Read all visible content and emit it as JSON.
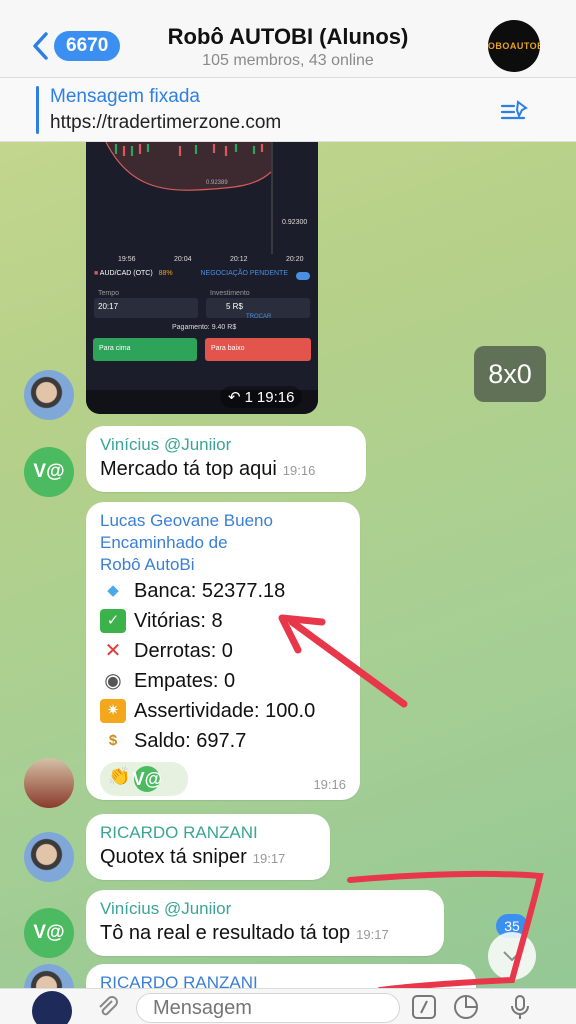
{
  "header": {
    "back_count": "6670",
    "title": "Robô AUTOBI (Alunos)",
    "subtitle": "105 membros, 43 online",
    "avatar_text": "ROBOAUTOBI"
  },
  "pinned": {
    "title": "Mensagem fixada",
    "text": "https://tradertimerzone.com"
  },
  "screenshot": {
    "price_label": "0.92300",
    "price_small": "0.92389",
    "times": [
      "19:56",
      "20:04",
      "20:12",
      "20:20"
    ],
    "pair": "AUD/CAD (OTC)",
    "pct": "88%",
    "pending": "NEGOCIAÇÃO PENDENTE",
    "tempo_label": "Tempo",
    "tempo_value": "20:17",
    "invest_label": "Investimento",
    "invest_value": "5 R$",
    "trocar": "TROCAR",
    "pagamento": "Pagamento: 9.40 R$",
    "up_label": "Para cima",
    "down_label": "Para baixo"
  },
  "reply_pill": {
    "count": "1",
    "time": "19:16"
  },
  "score_pill": "8x0",
  "messages": [
    {
      "sender": "Vinícius @Juniior",
      "text": "Mercado tá top aqui",
      "time": "19:16"
    },
    {
      "sender": "Lucas Geovane Bueno",
      "forwarded_label": "Encaminhado de",
      "forwarded_from": "Robô AutoBi",
      "stats": {
        "banca": "Banca: 52377.18",
        "vitorias": "Vitórias: 8",
        "derrotas": "Derrotas: 0",
        "empates": "Empates: 0",
        "assertividade": "Assertividade: 100.0",
        "saldo": "Saldo: 697.7"
      },
      "time": "19:16"
    },
    {
      "sender": "RICARDO RANZANI",
      "text": "Quotex tá sniper",
      "time": "19:17"
    },
    {
      "sender": "Vinícius @Juniior",
      "text": "Tô na real e resultado tá top",
      "time": "19:17"
    },
    {
      "sender": "RICARDO RANZANI"
    }
  ],
  "avatar_v_text": "V@",
  "unread_count": "35",
  "input": {
    "placeholder": "Mensagem"
  },
  "colors": {
    "accent": "#2d7fe6",
    "sender_green": "#3aa596",
    "sender_blue": "#3a7fd5",
    "annotation_red": "#e8364a"
  }
}
